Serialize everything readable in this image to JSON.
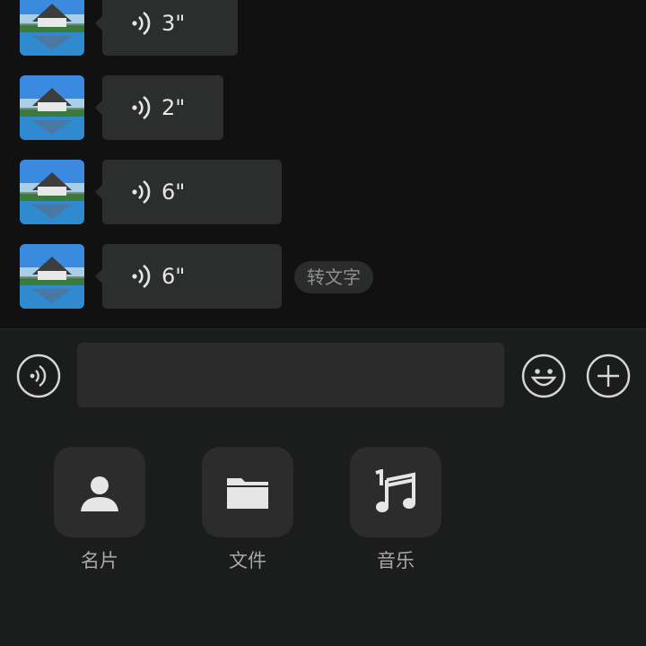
{
  "messages": [
    {
      "duration": "3\"",
      "convert": ""
    },
    {
      "duration": "2\"",
      "convert": ""
    },
    {
      "duration": "6\"",
      "convert": ""
    },
    {
      "duration": "6\"",
      "convert": "转文字"
    }
  ],
  "input": {
    "value": "",
    "placeholder": ""
  },
  "tools": [
    {
      "label": "名片",
      "icon": "person-card-icon"
    },
    {
      "label": "文件",
      "icon": "folder-icon"
    },
    {
      "label": "音乐",
      "icon": "music-note-icon"
    }
  ],
  "colors": {
    "background": "#111111",
    "bubble": "#2b2e2c",
    "panel": "#1b1d1c",
    "tile": "#2c2c2c"
  }
}
